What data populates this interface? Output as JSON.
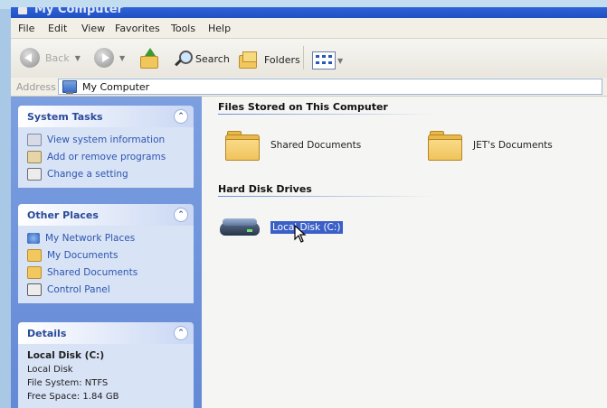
{
  "window": {
    "title": "My Computer"
  },
  "menu": [
    "File",
    "Edit",
    "View",
    "Favorites",
    "Tools",
    "Help"
  ],
  "toolbar": {
    "back_label": "Back",
    "search_label": "Search",
    "folders_label": "Folders"
  },
  "address": {
    "label": "Address",
    "value": "My Computer"
  },
  "system_tasks": {
    "title": "System Tasks",
    "items": [
      "View system information",
      "Add or remove programs",
      "Change a setting"
    ]
  },
  "other_places": {
    "title": "Other Places",
    "items": [
      "My Network Places",
      "My Documents",
      "Shared Documents",
      "Control Panel"
    ]
  },
  "details": {
    "title": "Details",
    "name": "Local Disk (C:)",
    "type": "Local Disk",
    "file_system": "File System: NTFS",
    "free_space": "Free Space: 1.84 GB"
  },
  "content": {
    "group_files": "Files Stored on This Computer",
    "group_drives": "Hard Disk Drives",
    "folders": [
      "Shared Documents",
      "JET's Documents"
    ],
    "drives": [
      "Local Disk (C:)"
    ]
  },
  "colors": {
    "selection": "#3a5fc7",
    "sidebar": "#7c9fe0",
    "link": "#2d56b0"
  }
}
